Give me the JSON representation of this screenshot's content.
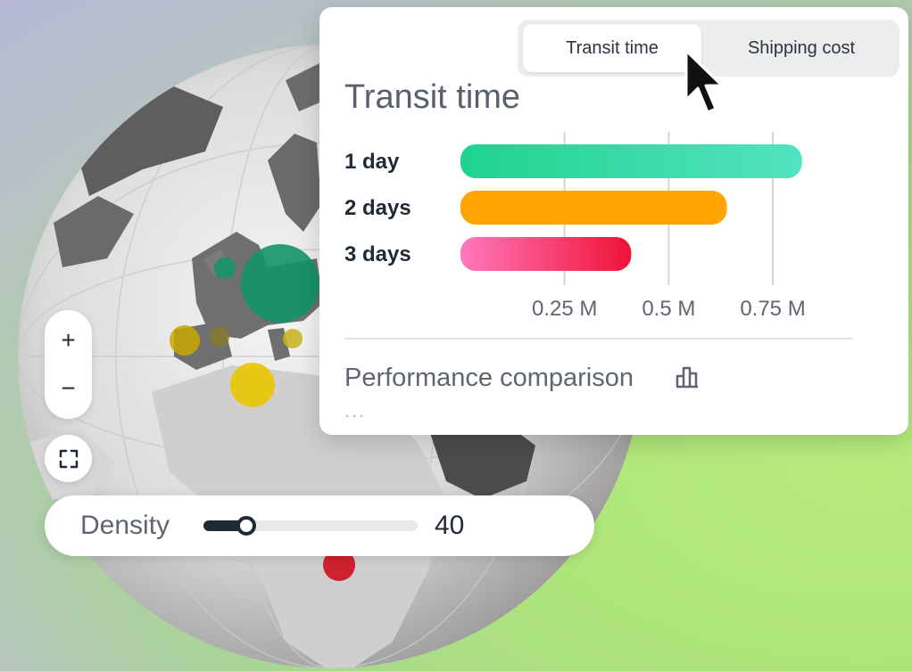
{
  "tabs": [
    {
      "label": "Transit time",
      "active": true
    },
    {
      "label": "Shipping cost",
      "active": false
    }
  ],
  "card": {
    "title": "Transit time",
    "footer_title": "Performance comparison",
    "footer_icon": "bar-chart-icon",
    "more": "..."
  },
  "chart_data": {
    "type": "bar",
    "orientation": "horizontal",
    "categories": [
      "1 day",
      "2 days",
      "3 days"
    ],
    "values": [
      0.82,
      0.64,
      0.41
    ],
    "value_unit": "M",
    "xticks": [
      0.25,
      0.5,
      0.75
    ],
    "xtick_labels": [
      "0.25 M",
      "0.5 M",
      "0.75 M"
    ],
    "xlim": [
      0,
      0.9
    ],
    "grid": "vertical",
    "colors": [
      [
        "#1fd38e",
        "#52e3c0"
      ],
      [
        "#ffa400",
        "#ffa400"
      ],
      [
        "#ff78bd",
        "#ee1436"
      ]
    ]
  },
  "zoom": {
    "in_icon": "+",
    "out_icon": "−",
    "fit_icon": "fullscreen-icon"
  },
  "density": {
    "label": "Density",
    "value": 40,
    "min": 0,
    "max": 200
  },
  "colors": {
    "ink": "#1f2a37",
    "muted": "#5f6670",
    "card_bg": "#ffffff"
  }
}
